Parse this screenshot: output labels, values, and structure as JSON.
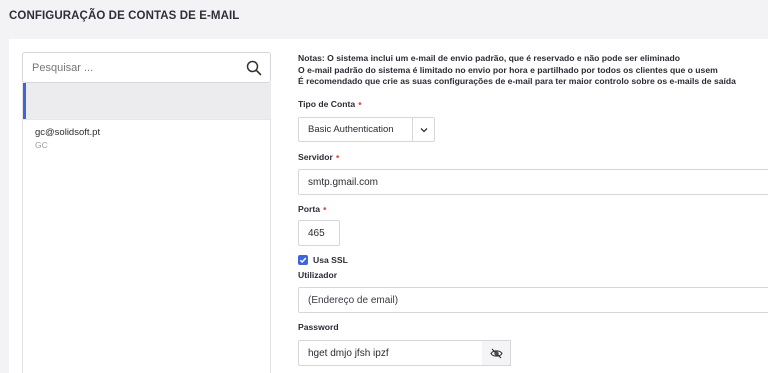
{
  "header": {
    "title": "CONFIGURAÇÃO DE CONTAS DE E-MAIL"
  },
  "search": {
    "placeholder": "Pesquisar ..."
  },
  "accounts": [
    {
      "email": "gc@solidsoft.pt",
      "sub": "GC"
    }
  ],
  "notes": [
    "Notas: O sistema inclui um e-mail de envio padrão, que é reservado e não pode ser eliminado",
    "O e-mail padrão do sistema é limitado no envio por hora e partilhado por todos os clientes que o usem",
    "É recomendado que crie as suas configurações de e-mail para ter maior controlo sobre os e-mails de saída"
  ],
  "form": {
    "tipo_conta_label": "Tipo de Conta",
    "tipo_conta_value": "Basic Authentication",
    "servidor_label": "Servidor",
    "servidor_value": "smtp.gmail.com",
    "porta_label": "Porta",
    "porta_value": "465",
    "ssl_label": "Usa SSL",
    "ssl_checked": true,
    "utilizador_label": "Utilizador",
    "utilizador_placeholder": "(Endereço de email)",
    "password_label": "Password",
    "password_value": "hget dmjo jfsh ipzf",
    "required_mark": "•"
  },
  "colors": {
    "accent": "#3e66d8",
    "required": "#e5484d"
  }
}
